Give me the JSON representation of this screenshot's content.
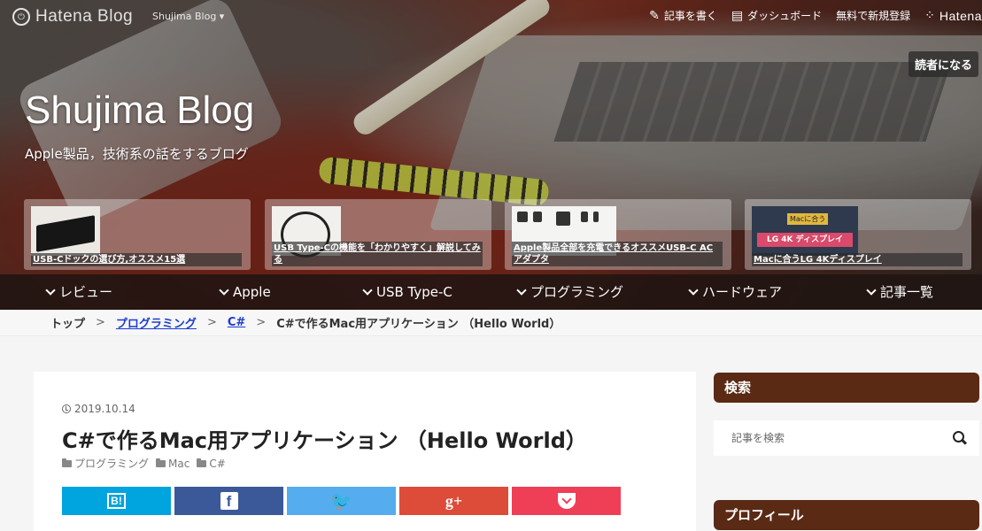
{
  "topbar": {
    "logo_text": "Hatena Blog",
    "blog_switch": "Shujima Blog ▾",
    "links": [
      {
        "icon": "pencil-square-icon",
        "label": "記事を書く"
      },
      {
        "icon": "dashboard-icon",
        "label": "ダッシュボード"
      },
      {
        "icon": "",
        "label": "無料で新規登録"
      }
    ],
    "hatena_label": "Hatena"
  },
  "subscribe_label": "読者になる",
  "blog": {
    "title": "Shujima Blog",
    "description": "Apple製品，技術系の話をするブログ"
  },
  "featured": [
    {
      "title": "USB-Cドックの選び方,オススメ15選"
    },
    {
      "title": "USB Type-Cの機能を「わかりやすく」解説してみる"
    },
    {
      "title": "Apple製品全部を充電できるオススメUSB-C ACアダプタ"
    },
    {
      "title": "Macに合うLG 4Kディスプレイ",
      "thumb_chip": "Macに合う",
      "thumb_band": "LG 4K ディスプレイ"
    }
  ],
  "categories": [
    "レビュー",
    "Apple",
    "USB Type-C",
    "プログラミング",
    "ハードウェア",
    "記事一覧"
  ],
  "breadcrumb": {
    "top": "トップ",
    "sep": ">",
    "cat1": "プログラミング",
    "cat2": "C#",
    "current": "C#で作るMac用アプリケーション （Hello World）"
  },
  "post": {
    "date": "2019.10.14",
    "title": "C#で作るMac用アプリケーション （Hello World）",
    "categories": [
      "プログラミング",
      "Mac",
      "C#"
    ]
  },
  "share": {
    "hatena": "B!",
    "facebook": "f",
    "twitter": "🐦",
    "gplus": "g+"
  },
  "sidebar": {
    "search_heading": "検索",
    "search_placeholder": "記事を検索",
    "profile_heading": "プロフィール"
  },
  "colors": {
    "sidebar_heading": "#5a2a15",
    "hatena_bookmark": "#00a4de",
    "facebook": "#3b5998",
    "twitter": "#55acee",
    "gplus": "#dd4b39",
    "pocket": "#ef3f56",
    "breadcrumb_link": "#1a3ccf"
  }
}
